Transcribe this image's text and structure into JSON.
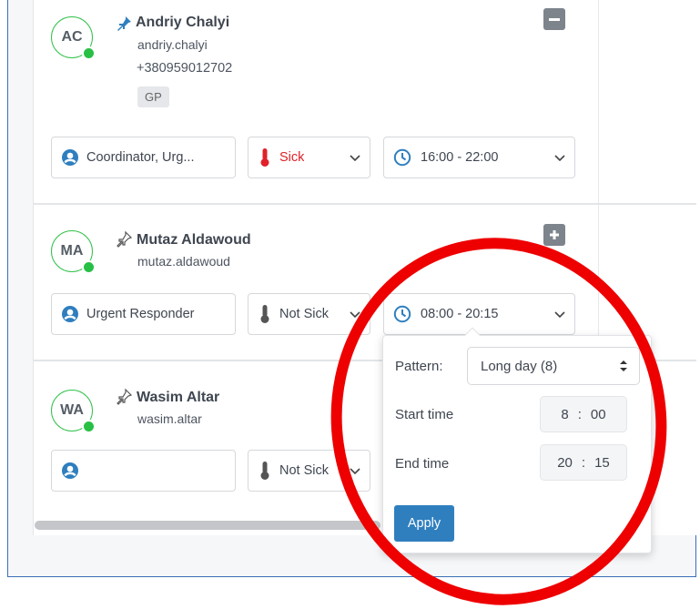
{
  "rows": [
    {
      "initials": "AC",
      "name": "Andriy Chalyi",
      "username": "andriy.chalyi",
      "phone": "+380959012702",
      "tag": "GP",
      "pinned": true,
      "role": "Coordinator, Urg...",
      "sick_status": "Sick",
      "shift_time": "16:00 - 22:00"
    },
    {
      "initials": "MA",
      "name": "Mutaz Aldawoud",
      "username": "mutaz.aldawoud",
      "pinned": false,
      "role": "Urgent Responder",
      "sick_status": "Not Sick",
      "shift_time": "08:00 - 20:15"
    },
    {
      "initials": "WA",
      "name": "Wasim Altar",
      "username": "wasim.altar",
      "pinned": false,
      "role": "",
      "sick_status": "Not Sick"
    }
  ],
  "popover": {
    "pattern_label": "Pattern:",
    "pattern_value": "Long day (8)",
    "start_label": "Start time",
    "start_hour": "8",
    "start_min": "00",
    "end_label": "End time",
    "end_hour": "20",
    "end_min": "15",
    "apply_label": "Apply"
  },
  "colors": {
    "online": "#27c044",
    "sick": "#e0212a",
    "apply": "#2f7fbf",
    "annotation": "#ee0000"
  }
}
